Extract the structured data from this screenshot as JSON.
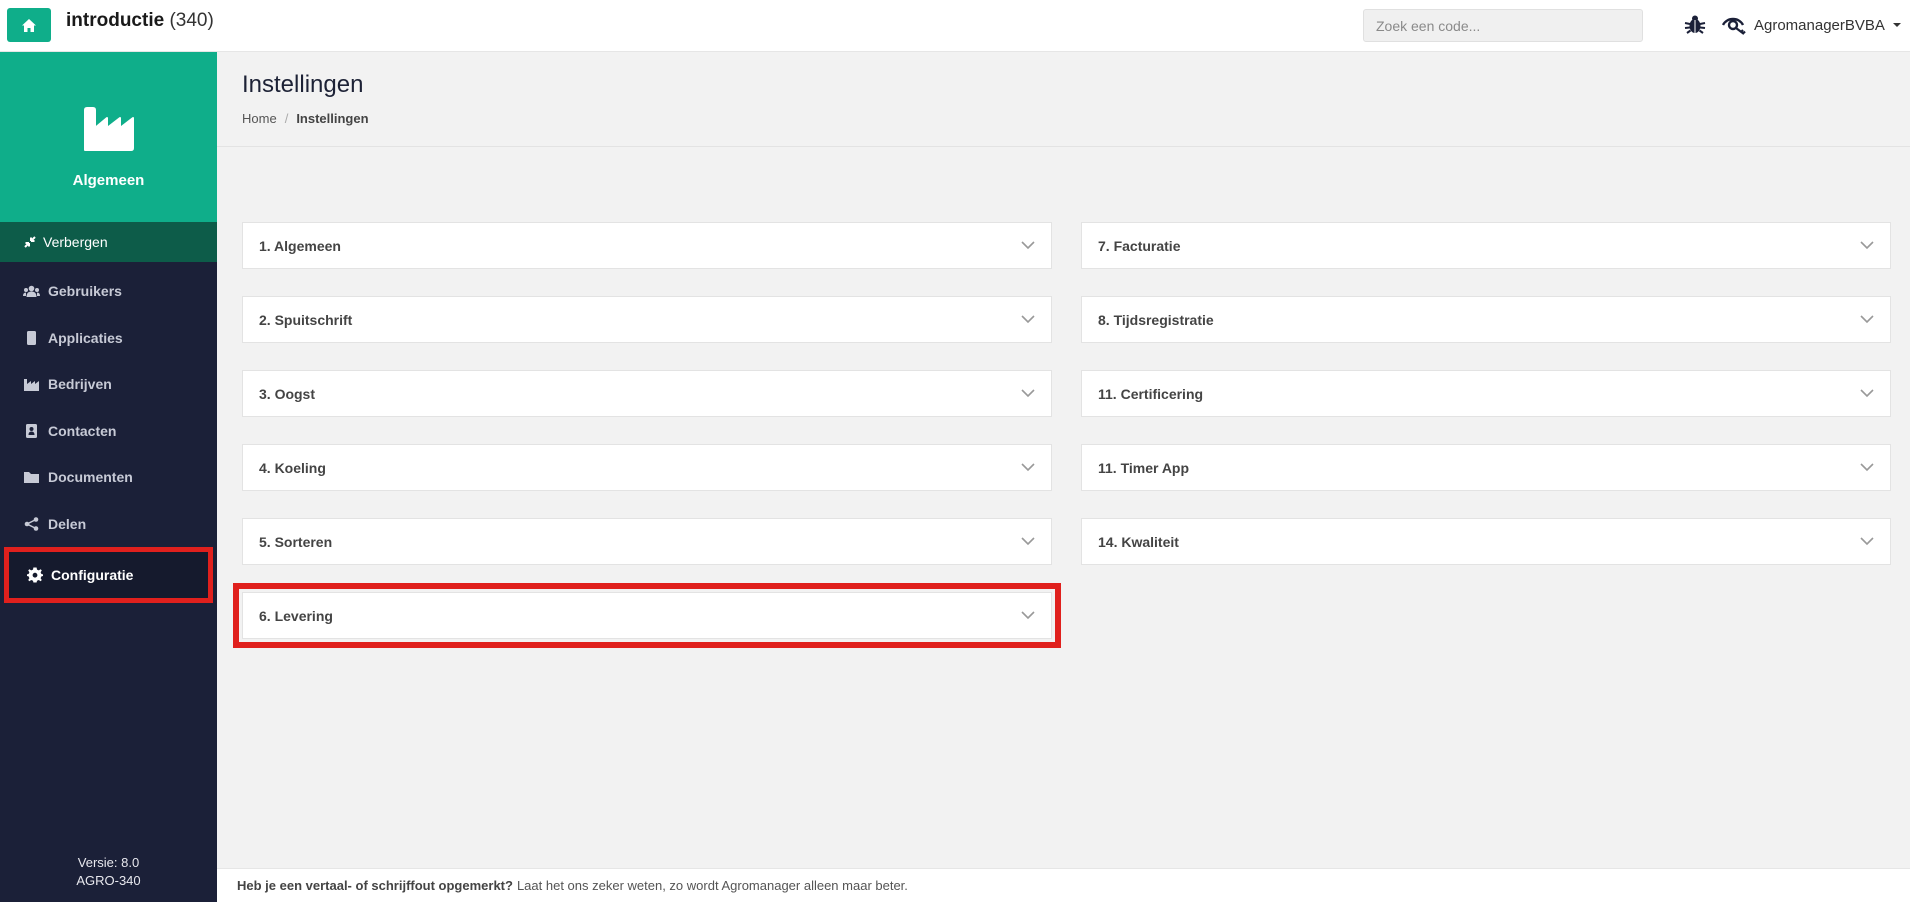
{
  "topbar": {
    "project_name": "introductie",
    "project_count": "(340)",
    "search_placeholder": "Zoek een code...",
    "user_name": "AgromanagerBVBA",
    "accent": "#0fae8a"
  },
  "sidebar": {
    "title": "Algemeen",
    "hide_label": "Verbergen",
    "items": [
      {
        "label": "Gebruikers",
        "icon": "users-icon"
      },
      {
        "label": "Applicaties",
        "icon": "mobile-icon"
      },
      {
        "label": "Bedrijven",
        "icon": "factory-icon"
      },
      {
        "label": "Contacten",
        "icon": "contact-book-icon"
      },
      {
        "label": "Documenten",
        "icon": "folder-icon"
      },
      {
        "label": "Delen",
        "icon": "share-icon"
      },
      {
        "label": "Configuratie",
        "icon": "gear-icon"
      }
    ],
    "version_label": "Versie: 8.0",
    "version_code": "AGRO-340"
  },
  "page": {
    "title": "Instellingen",
    "breadcrumb": {
      "home": "Home",
      "separator": "/",
      "current": "Instellingen"
    }
  },
  "panels": {
    "left": [
      "1. Algemeen",
      "2. Spuitschrift",
      "3. Oogst",
      "4. Koeling",
      "5. Sorteren",
      "6. Levering"
    ],
    "right": [
      "7. Facturatie",
      "8. Tijdsregistratie",
      "11. Certificering",
      "11. Timer App",
      "14. Kwaliteit"
    ]
  },
  "footer": {
    "bold": "Heb je een vertaal- of schrijffout opgemerkt?",
    "text": "Laat het ons zeker weten, zo wordt Agromanager alleen maar beter."
  },
  "highlight_color": "#e0201d"
}
